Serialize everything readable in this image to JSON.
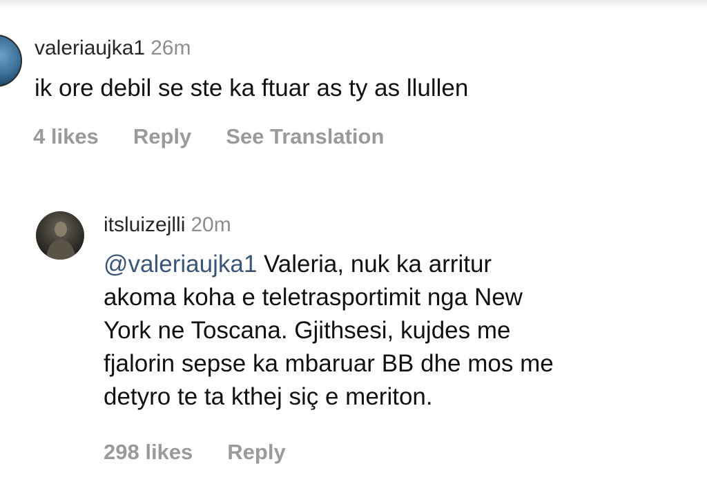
{
  "comments": [
    {
      "username": "valeriaujka1",
      "time": "26m",
      "text": "ik ore debil se ste ka ftuar as ty as llullen",
      "likes": "4 likes",
      "reply": "Reply",
      "translate": "See Translation"
    },
    {
      "username": "itsluizejlli",
      "time": "20m",
      "mention": "@valeriaujka1",
      "text_lines": [
        "Valeria, nuk ka arritur",
        "akoma koha e teletrasportimit nga New",
        "York ne Toscana. Gjithsesi, kujdes me",
        "fjalorin sepse ka mbaruar BB dhe mos me",
        "detyro te ta kthej siç e meriton."
      ],
      "likes": "298 likes",
      "reply": "Reply"
    }
  ]
}
